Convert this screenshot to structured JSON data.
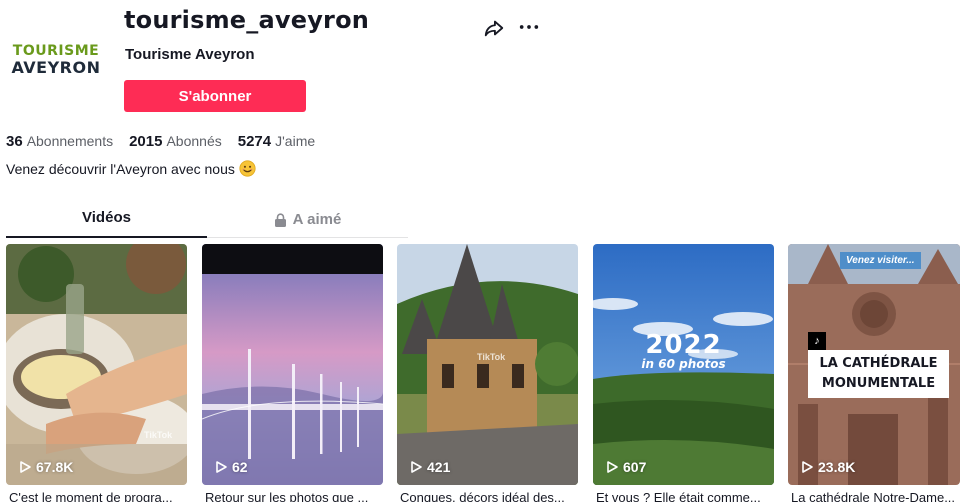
{
  "profile": {
    "avatar_line1": "TOURISME",
    "avatar_line2": "AVEYRON",
    "username": "tourisme_aveyron",
    "nickname": "Tourisme Aveyron",
    "follow_label": "S'abonner",
    "bio": "Venez découvrir l'Aveyron avec nous",
    "bio_emoji": "smile-emoji-icon"
  },
  "stats": [
    {
      "value": "36",
      "label": "Abonnements"
    },
    {
      "value": "2015",
      "label": "Abonnés"
    },
    {
      "value": "5274",
      "label": "J'aime"
    }
  ],
  "tabs": [
    {
      "label": "Vidéos",
      "active": true
    },
    {
      "label": "A aimé",
      "active": false,
      "icon": "lock-icon"
    }
  ],
  "videos": [
    {
      "views": "67.8K",
      "caption": "C'est le moment de progra...",
      "watermark": "TikTok"
    },
    {
      "views": "62",
      "caption": "Retour sur les photos que ..."
    },
    {
      "views": "421",
      "caption": "Conques, décors idéal des...",
      "watermark": "TikTok"
    },
    {
      "views": "607",
      "caption": "Et vous ? Elle était comme...",
      "overlay_big": "2022",
      "overlay_small": "in 60 photos"
    },
    {
      "views": "23.8K",
      "caption": "La cathédrale Notre-Dame...",
      "overlay_tag": "Venez visiter...",
      "overlay_line1": "LA CATHÉDRALE",
      "overlay_line2": "MONUMENTALE"
    }
  ],
  "colors": {
    "accent": "#fe2c55",
    "text": "#161823",
    "muted": "#8a8b91",
    "brand_green": "#6a9a1c",
    "brand_navy": "#1f2b3a"
  }
}
